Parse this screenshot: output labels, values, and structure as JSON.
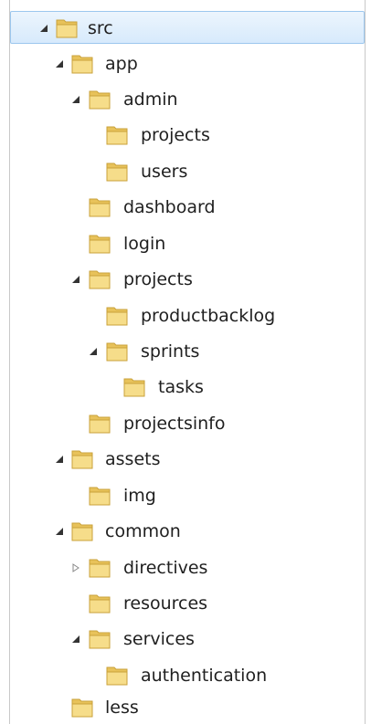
{
  "tree": {
    "nodes": [
      {
        "label": "src",
        "state": "expanded",
        "selected": true
      },
      {
        "label": "app",
        "state": "expanded"
      },
      {
        "label": "admin",
        "state": "expanded"
      },
      {
        "label": "projects",
        "state": "leaf"
      },
      {
        "label": "users",
        "state": "leaf"
      },
      {
        "label": "dashboard",
        "state": "leaf"
      },
      {
        "label": "login",
        "state": "leaf"
      },
      {
        "label": "projects",
        "state": "expanded"
      },
      {
        "label": "productbacklog",
        "state": "leaf"
      },
      {
        "label": "sprints",
        "state": "expanded"
      },
      {
        "label": "tasks",
        "state": "leaf"
      },
      {
        "label": "projectsinfo",
        "state": "leaf"
      },
      {
        "label": "assets",
        "state": "expanded"
      },
      {
        "label": "img",
        "state": "leaf"
      },
      {
        "label": "common",
        "state": "expanded"
      },
      {
        "label": "directives",
        "state": "collapsed"
      },
      {
        "label": "resources",
        "state": "leaf"
      },
      {
        "label": "services",
        "state": "expanded"
      },
      {
        "label": "authentication",
        "state": "leaf"
      },
      {
        "label": "less",
        "state": "leaf"
      }
    ]
  },
  "icons": {
    "folder": "folder-icon",
    "expanded": "triangle-expanded-icon",
    "collapsed": "triangle-collapsed-icon"
  },
  "colors": {
    "selection_fill": "#d7eafc",
    "selection_border": "#9cc7ee",
    "folder": "#e8c25a"
  }
}
